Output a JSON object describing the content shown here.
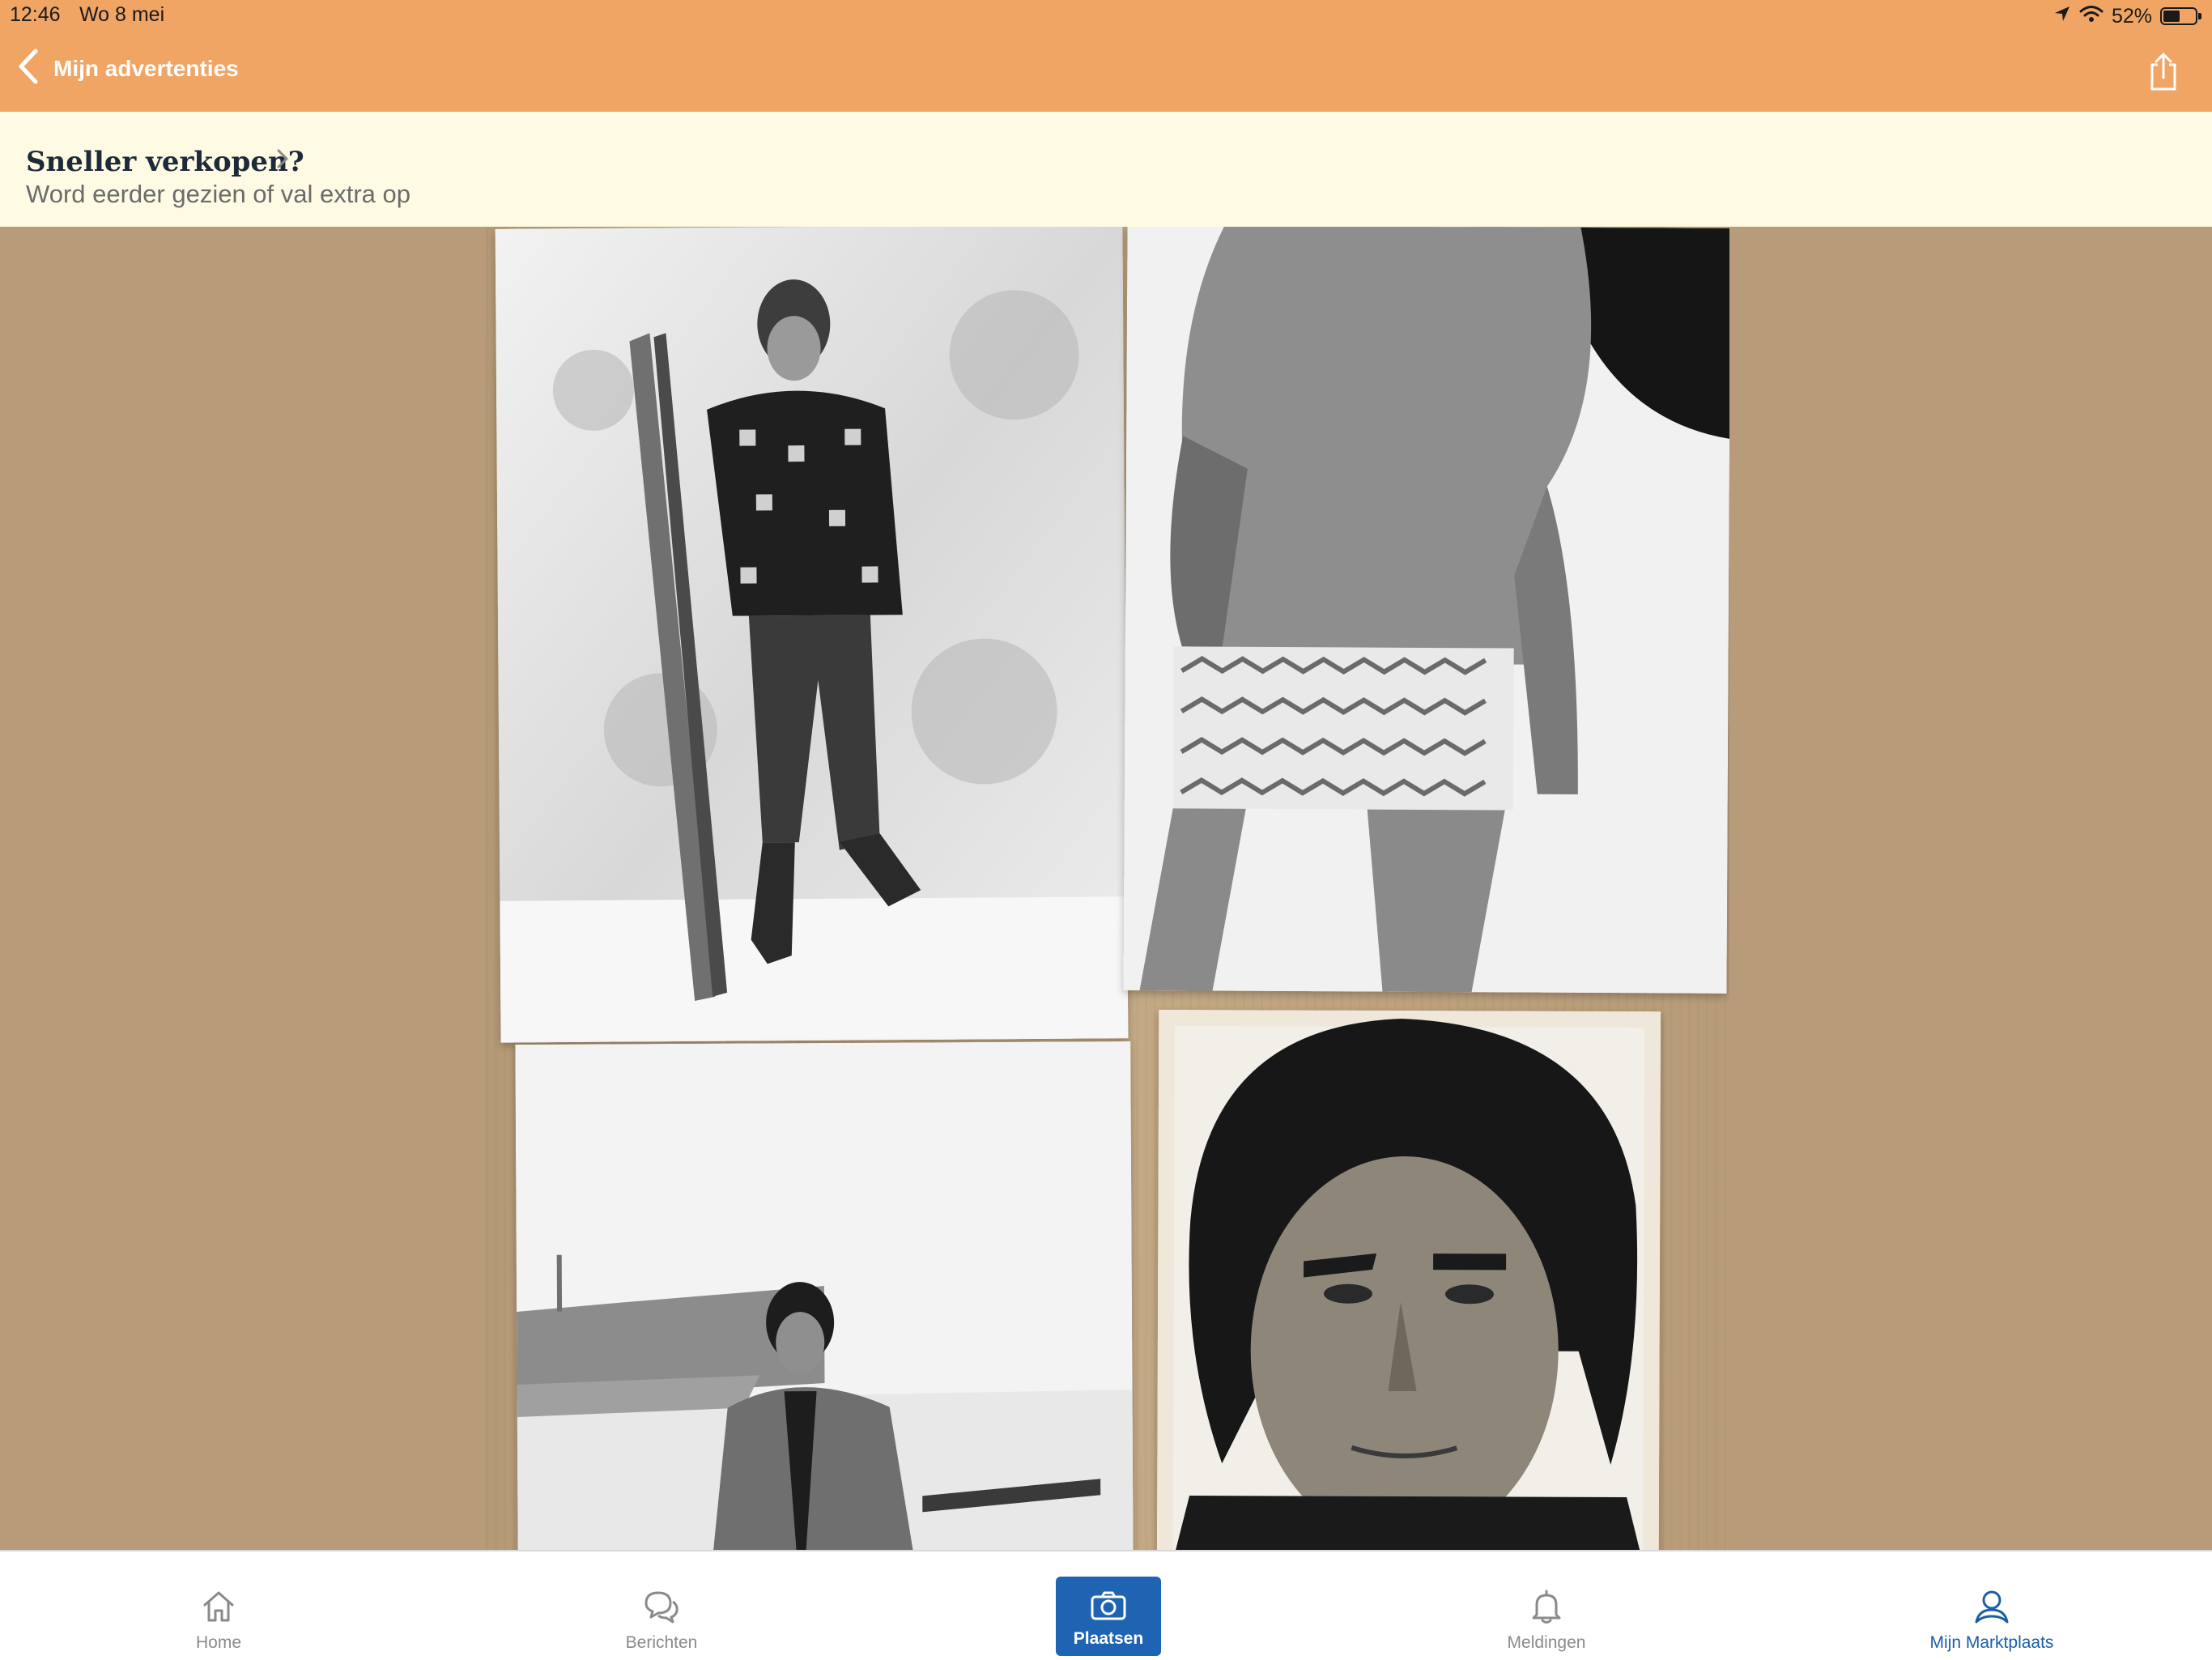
{
  "status_bar": {
    "time": "12:46",
    "date": "Wo 8 mei",
    "battery_text": "52%",
    "battery_level": 0.52
  },
  "nav_bar": {
    "back_label": "Mijn advertenties",
    "back_icon": "chevron-left-icon",
    "share_icon": "share-icon"
  },
  "promo": {
    "title": "Sneller verkopen?",
    "subtitle": "Word eerder gezien of val extra op",
    "chevron_icon": "chevron-right-icon"
  },
  "photo": {
    "description_icons": [
      "ski-photo",
      "swimwear-photo",
      "suit-photo",
      "portrait-photo"
    ]
  },
  "tabs": [
    {
      "label": "Home",
      "icon": "home-icon",
      "active": false
    },
    {
      "label": "Berichten",
      "icon": "chat-bubbles-icon",
      "active": false
    },
    {
      "label": "Plaatsen",
      "icon": "camera-icon",
      "active": false
    },
    {
      "label": "Meldingen",
      "icon": "bell-icon",
      "active": false
    },
    {
      "label": "Mijn Marktplaats",
      "icon": "user-icon",
      "active": true
    }
  ],
  "colors": {
    "header": "#f0a565",
    "promo_bg": "#fefae3",
    "accent_blue": "#1f63b3",
    "active_tab": "#1a5ea8"
  }
}
